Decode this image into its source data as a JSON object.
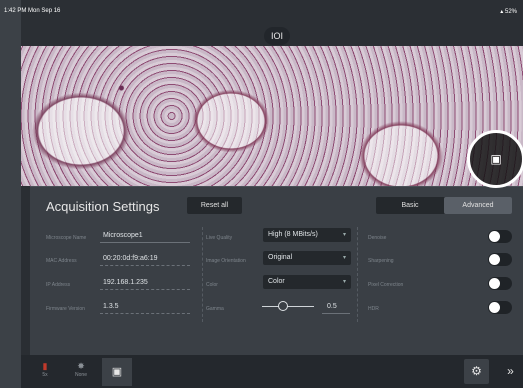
{
  "status_bar": {
    "time": "1:42 PM  Mon Sep 16",
    "battery": "52%"
  },
  "top_bar": {
    "camera_toggle_icon": "ioi-icon"
  },
  "snapshot": {
    "icon": "camera-icon"
  },
  "panel": {
    "title": "Acquisition Settings",
    "reset_label": "Reset all",
    "modes": {
      "basic": "Basic",
      "advanced": "Advanced",
      "selected": "Advanced"
    },
    "left": [
      {
        "label": "Microscope Name",
        "value": "Microscope1"
      },
      {
        "label": "MAC Address",
        "value": "00:20:0d:f9:a6:19"
      },
      {
        "label": "IP Address",
        "value": "192.168.1.235"
      },
      {
        "label": "Firmware Version",
        "value": "1.3.5"
      }
    ],
    "middle": {
      "live_quality": {
        "label": "Live Quality",
        "value": "High (8 MBits/s)"
      },
      "orientation": {
        "label": "Image Orientation",
        "value": "Original"
      },
      "color": {
        "label": "Color",
        "value": "Color"
      },
      "gamma": {
        "label": "Gamma",
        "value": "0.5",
        "level": 0.4
      }
    },
    "right": [
      {
        "label": "Denoise",
        "on": false
      },
      {
        "label": "Sharpening",
        "on": false
      },
      {
        "label": "Pixel Correction",
        "on": false
      },
      {
        "label": "HDR",
        "on": false
      }
    ]
  },
  "bottom_bar": {
    "tools": [
      {
        "label": "5x",
        "icon": "objective-icon"
      },
      {
        "label": "None",
        "icon": "light-icon"
      },
      {
        "label": "",
        "icon": "camera-settings-icon"
      }
    ],
    "settings_icon": "gear-icon",
    "collapse_icon": "double-chevron-down-icon"
  },
  "colors": {
    "accent": "#ffffff",
    "panel": "#3a3f45",
    "dark": "#24282c"
  }
}
